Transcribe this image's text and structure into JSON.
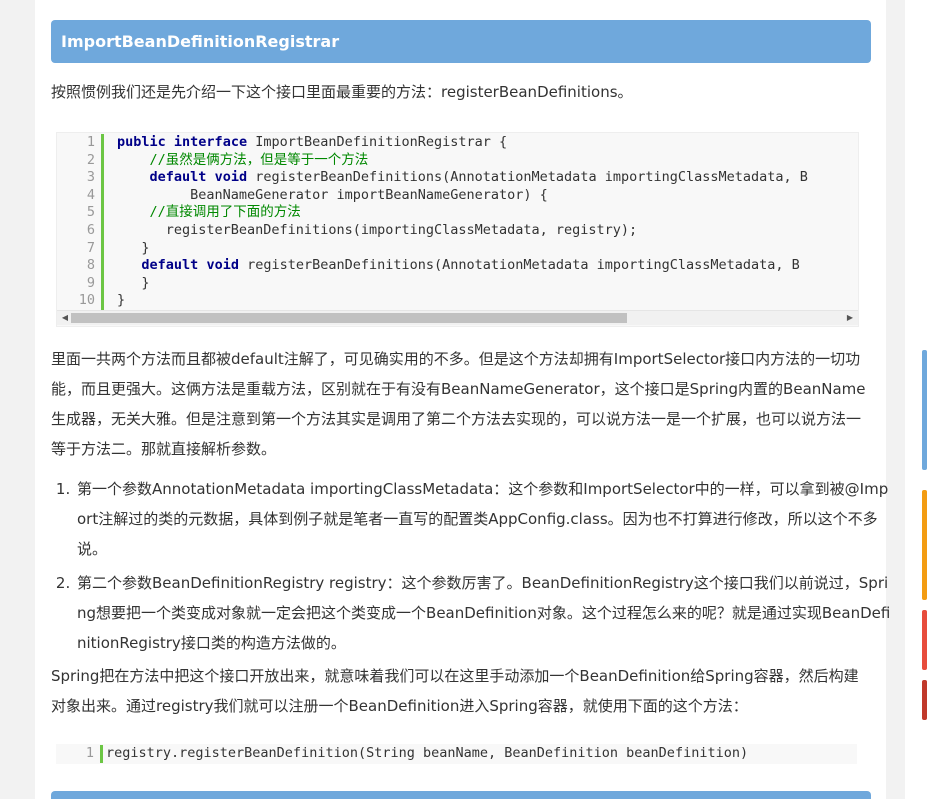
{
  "heading": "ImportBeanDefinitionRegistrar",
  "intro": "按照惯例我们还是先介绍一下这个接口里面最重要的方法：registerBeanDefinitions。",
  "code_block_1": {
    "line_numbers": [
      "1",
      "2",
      "3",
      "4",
      "5",
      "6",
      "7",
      "8",
      "9",
      "10"
    ],
    "lines": [
      [
        {
          "t": "kw",
          "v": "public"
        },
        {
          "t": "",
          "v": " "
        },
        {
          "t": "kw",
          "v": "interface"
        },
        {
          "t": "",
          "v": " ImportBeanDefinitionRegistrar {"
        }
      ],
      [
        {
          "t": "",
          "v": "    "
        },
        {
          "t": "cm",
          "v": "//虽然是俩方法，但是等于一个方法"
        }
      ],
      [
        {
          "t": "",
          "v": "    "
        },
        {
          "t": "kw",
          "v": "default"
        },
        {
          "t": "",
          "v": " "
        },
        {
          "t": "kw",
          "v": "void"
        },
        {
          "t": "",
          "v": " registerBeanDefinitions(AnnotationMetadata importingClassMetadata, B"
        }
      ],
      [
        {
          "t": "",
          "v": "         BeanNameGenerator importBeanNameGenerator) {"
        }
      ],
      [
        {
          "t": "",
          "v": "    "
        },
        {
          "t": "cm",
          "v": "//直接调用了下面的方法"
        }
      ],
      [
        {
          "t": "",
          "v": "      registerBeanDefinitions(importingClassMetadata, registry);"
        }
      ],
      [
        {
          "t": "",
          "v": "   }"
        }
      ],
      [
        {
          "t": "",
          "v": "   "
        },
        {
          "t": "kw",
          "v": "default"
        },
        {
          "t": "",
          "v": " "
        },
        {
          "t": "kw",
          "v": "void"
        },
        {
          "t": "",
          "v": " registerBeanDefinitions(AnnotationMetadata importingClassMetadata, B"
        }
      ],
      [
        {
          "t": "",
          "v": "   }"
        }
      ],
      [
        {
          "t": "",
          "v": "}"
        }
      ]
    ]
  },
  "para_1": "里面一共两个方法而且都被default注解了，可见确实用的不多。但是这个方法却拥有ImportSelector接口内方法的一切功能，而且更强大。这俩方法是重载方法，区别就在于有没有BeanNameGenerator，这个接口是Spring内置的BeanName生成器，无关大雅。但是注意到第一个方法其实是调用了第二个方法去实现的，可以说方法一是一个扩展，也可以说方法一等于方法二。那就直接解析参数。",
  "list_items": [
    "第一个参数AnnotationMetadata importingClassMetadata：这个参数和ImportSelector中的一样，可以拿到被@Import注解过的类的元数据，具体到例子就是笔者一直写的配置类AppConfig.class。因为也不打算进行修改，所以这个不多说。",
    "第二个参数BeanDefinitionRegistry registry：这个参数厉害了。BeanDefinitionRegistry这个接口我们以前说过，Spring想要把一个类变成对象就一定会把这个类变成一个BeanDefinition对象。这个过程怎么来的呢？就是通过实现BeanDefinitionRegistry接口类的构造方法做的。"
  ],
  "para_2": "Spring把在方法中把这个接口开放出来，就意味着我们可以在这里手动添加一个BeanDefinition给Spring容器，然后构建对象出来。通过registry我们就可以注册一个BeanDefinition进入Spring容器，就使用下面的这个方法：",
  "code_block_2": {
    "line_number": "1",
    "code": "registry.registerBeanDefinition(String beanName, BeanDefinition beanDefinition)"
  },
  "colors": {
    "heading_bg": "#6fa8dc",
    "keyword": "#000088",
    "comment": "#008800",
    "gutter_border": "#6cc644"
  }
}
